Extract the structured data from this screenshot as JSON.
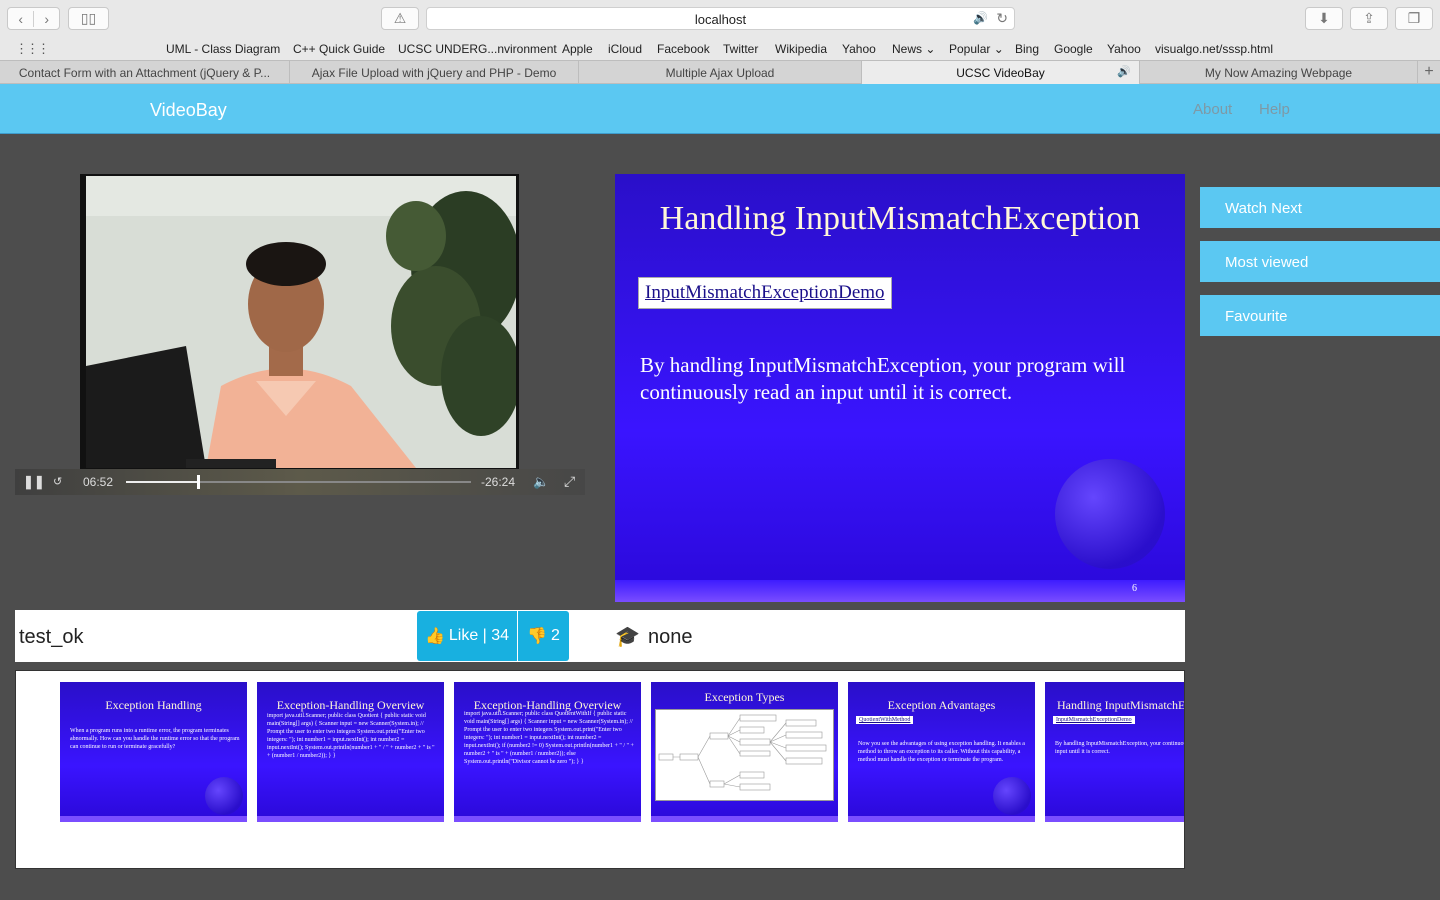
{
  "browser": {
    "url": "localhost",
    "bookmarks": [
      "UML - Class Diagram",
      "C++ Quick Guide",
      "UCSC UNDERG...nvironment",
      "Apple",
      "iCloud",
      "Facebook",
      "Twitter",
      "Wikipedia",
      "Yahoo",
      "News ⌄",
      "Popular ⌄",
      "Bing",
      "Google",
      "Yahoo",
      "visualgo.net/sssp.html"
    ],
    "tabs": [
      {
        "label": "Contact Form with an Attachment (jQuery & P...",
        "active": false
      },
      {
        "label": "Ajax File Upload with jQuery and PHP - Demo",
        "active": false
      },
      {
        "label": "Multiple Ajax Upload",
        "active": false
      },
      {
        "label": "UCSC VideoBay",
        "active": true
      },
      {
        "label": "My Now Amazing Webpage",
        "active": false
      }
    ]
  },
  "app": {
    "brand": "VideoBay",
    "nav": {
      "about": "About",
      "help": "Help"
    },
    "side_menu": {
      "watch_next": "Watch Next",
      "most_viewed": "Most viewed",
      "favourite": "Favourite"
    }
  },
  "player": {
    "elapsed": "06:52",
    "remaining": "-26:24",
    "progress": 0.21
  },
  "slide": {
    "title": "Handling InputMismatchException",
    "code_label": "InputMismatchExceptionDemo",
    "text": "By handling InputMismatchException, your program will continuously read an input until it is correct.",
    "page_number": "6"
  },
  "video_info": {
    "title": "test_ok",
    "like_label": "Like | 34",
    "dislike_count": "2",
    "category": "none"
  },
  "thumbnails": [
    {
      "title": "Exception Handling",
      "body": "When a program runs into a runtime error, the program terminates abnormally. How can you handle the runtime error so that the program can continue to run or terminate gracefully?"
    },
    {
      "title": "Exception-Handling Overview",
      "body": "import java.util.Scanner; public class Quotient { public static void main(String[] args) { Scanner input = new Scanner(System.in); // Prompt the user to enter two integers System.out.print(\"Enter two integers: \"); int number1 = input.nextInt(); int number2 = input.nextInt(); System.out.println(number1 + \" / \" + number2 + \" is \" + (number1 / number2)); } }"
    },
    {
      "title": "Exception-Handling Overview",
      "body": "import java.util.Scanner; public class QuotientWithIf { public static void main(String[] args) { Scanner input = new Scanner(System.in); // Prompt the user to enter two integers System.out.print(\"Enter two integers: \"); int number1 = input.nextInt(); int number2 = input.nextInt(); if (number2 != 0) System.out.println(number1 + \" / \" + number2 + \" is \" + (number1 / number2)); else System.out.println(\"Divisor cannot be zero \"); } }"
    },
    {
      "title": "Exception Types",
      "body": ""
    },
    {
      "title": "Exception Advantages",
      "box": "QuotientWithMethod",
      "body": "Now you see the advantages of using exception handling. It enables a method to throw an exception to its caller. Without this capability, a method must handle the exception or terminate the program."
    },
    {
      "title": "Handling InputMismatchEx",
      "box": "InputMismatchExceptionDemo",
      "body": "By handling InputMismatchException, your continuously read an input until it is correct."
    }
  ]
}
